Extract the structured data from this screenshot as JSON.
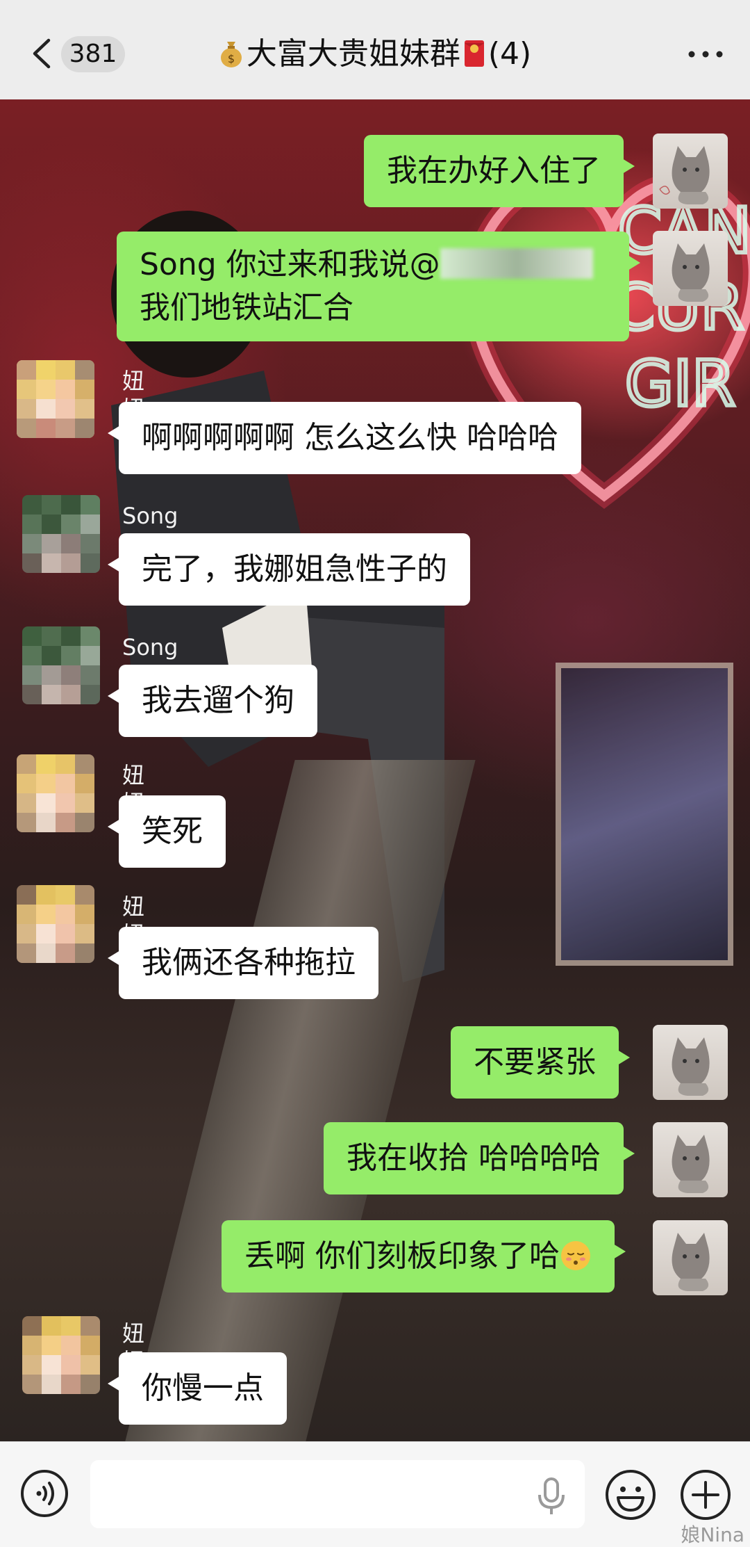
{
  "header": {
    "unread_count": "381",
    "title_text": "大富大贵姐妹群",
    "member_count": "(4)",
    "icons": {
      "back": "chevron-left-icon",
      "title_prefix": "money-bag-emoji",
      "title_suffix": "red-packet-emoji",
      "more": "more-dots-icon"
    }
  },
  "messages": [
    {
      "side": "right",
      "text": "我在办好入住了"
    },
    {
      "side": "right",
      "line1_prefix": "Song 你过来和我说@",
      "line2": "我们地铁站汇合"
    },
    {
      "side": "left",
      "sender": "妞妞",
      "text": "啊啊啊啊啊 怎么这么快 哈哈哈"
    },
    {
      "side": "left",
      "sender": "Song",
      "text": "完了，我娜姐急性子的"
    },
    {
      "side": "left",
      "sender": "Song",
      "text": "我去遛个狗"
    },
    {
      "side": "left",
      "sender": "妞妞",
      "text": "笑死"
    },
    {
      "side": "left",
      "sender": "妞妞",
      "text": "我俩还各种拖拉"
    },
    {
      "side": "right",
      "text": "不要紧张"
    },
    {
      "side": "right",
      "text": "我在收拾 哈哈哈哈"
    },
    {
      "side": "right",
      "text": "丢啊 你们刻板印象了哈",
      "emoji": "pensive-face-emoji"
    },
    {
      "side": "left",
      "sender": "妞妞",
      "text": "你慢一点"
    }
  ],
  "composer": {
    "input_value": "",
    "icons": {
      "voice": "voice-mode-icon",
      "mic": "microphone-icon",
      "emoji": "emoji-icon",
      "plus": "plus-icon"
    }
  },
  "watermark": "娘Nina",
  "colors": {
    "my_bubble": "#95ec69",
    "their_bubble": "#ffffff",
    "top_bar": "#ededed"
  }
}
